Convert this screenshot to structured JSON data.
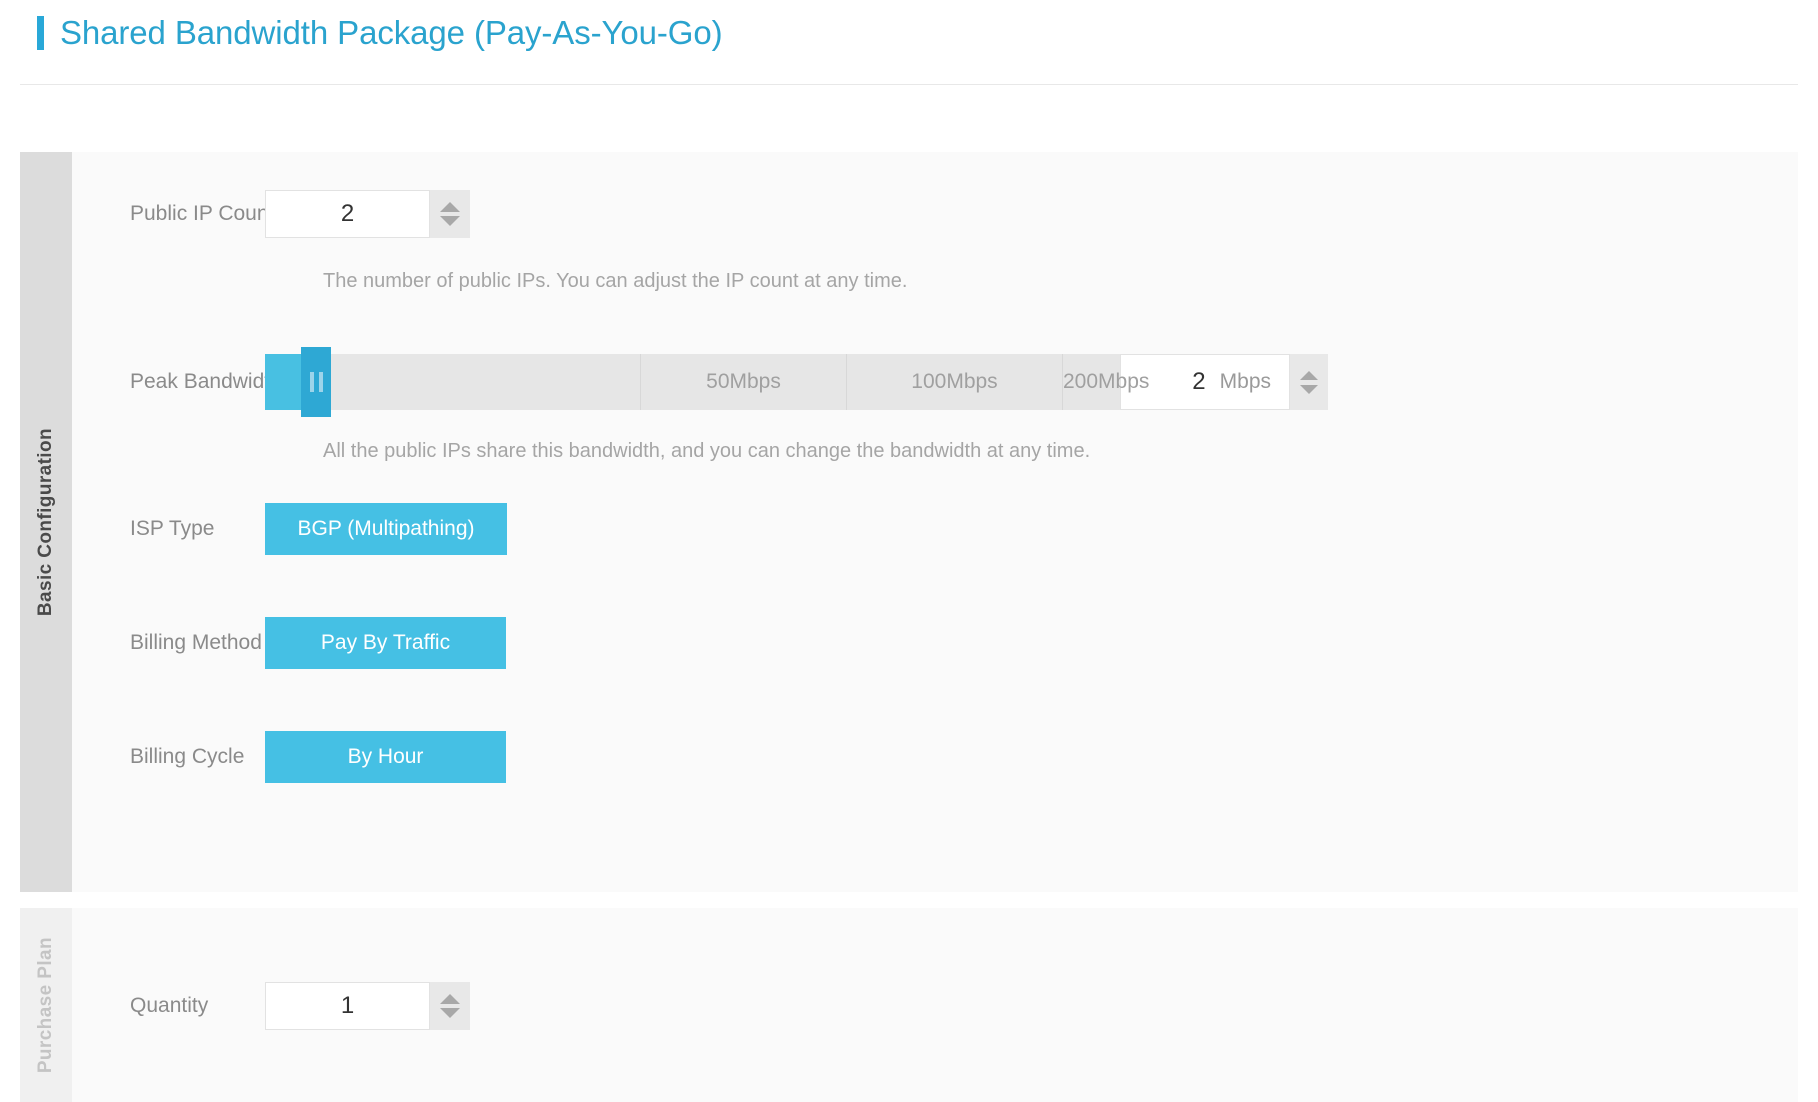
{
  "header": {
    "title": "Shared Bandwidth Package (Pay-As-You-Go)",
    "accent_color": "#29a8d8",
    "title_color": "#2aa3ce"
  },
  "panels": {
    "basic": {
      "tab_label": "Basic Configuration",
      "active": true,
      "fields": {
        "public_ip_count": {
          "label": "Public IP Count",
          "value": "2",
          "helper": "The number of public IPs. You can adjust the IP count at any time.",
          "spinner_up": "increase-arrow",
          "spinner_down": "decrease-arrow"
        },
        "peak_bandwidth": {
          "label": "Peak Bandwidth",
          "value": "2",
          "unit": "Mbps",
          "helper": "All the public IPs share this bandwidth, and you can change the bandwidth at any time.",
          "ticks": [
            "",
            "50Mbps",
            "100Mbps",
            "200Mbps"
          ],
          "fill_color": "#48c0e2",
          "handle_color": "#2ea8d4",
          "track_color": "#e6e6e6"
        },
        "isp_type": {
          "label": "ISP Type",
          "selected": "BGP (Multipathing)"
        },
        "billing_method": {
          "label": "Billing Method",
          "selected": "Pay By Traffic"
        },
        "billing_cycle": {
          "label": "Billing Cycle",
          "selected": "By Hour"
        }
      }
    },
    "purchase": {
      "tab_label": "Purchase Plan",
      "active": false,
      "fields": {
        "quantity": {
          "label": "Quantity",
          "value": "1"
        }
      }
    }
  },
  "colors": {
    "accent": "#45c0e4",
    "panel_bg": "#fafafa",
    "tab_active_bg": "#dcdcdc",
    "tab_inactive_bg": "#f0f0f0",
    "label_text": "#8a8a8a",
    "helper_text": "#a5a5a5"
  }
}
